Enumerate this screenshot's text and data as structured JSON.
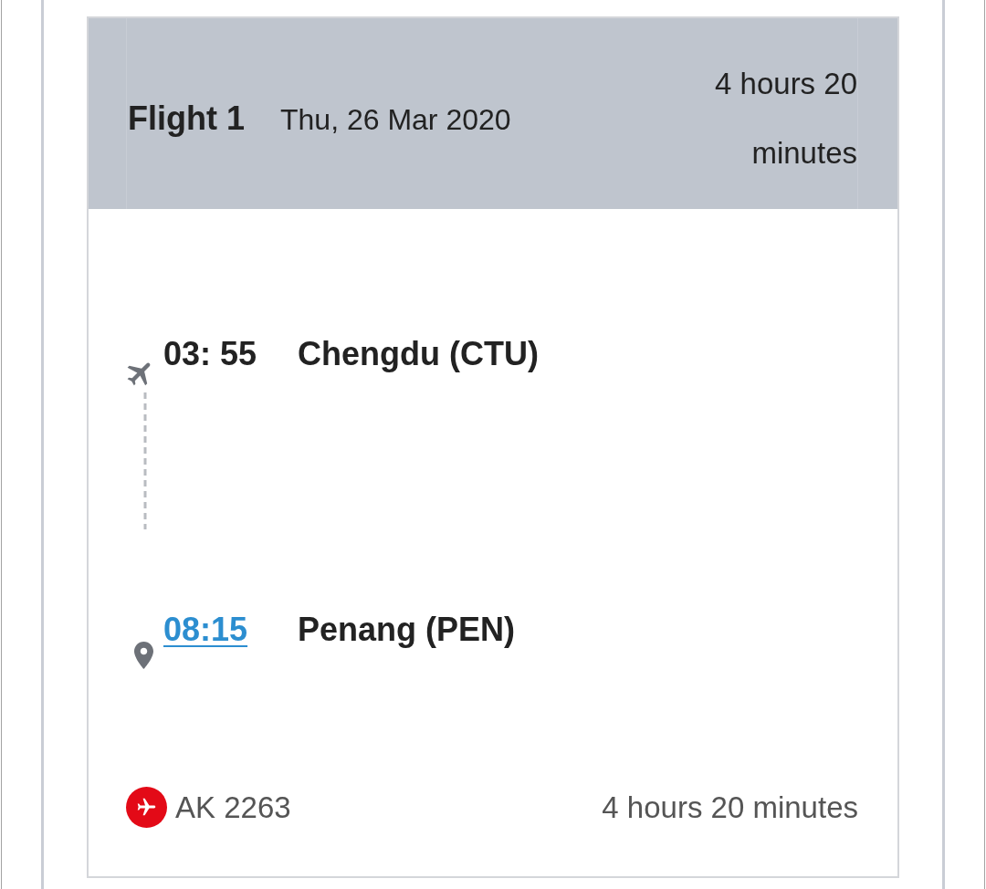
{
  "flight": {
    "title": "Flight 1",
    "date": "Thu, 26 Mar 2020",
    "duration": "4 hours 20 minutes"
  },
  "stops": [
    {
      "kind": "departure",
      "time": "03: 55",
      "place": "Chengdu (CTU)",
      "linked": false
    },
    {
      "kind": "arrival",
      "time": "08:15",
      "place": "Penang (PEN)",
      "linked": true
    }
  ],
  "footer": {
    "flight_number": "AK 2263",
    "duration": "4 hours 20 minutes"
  }
}
